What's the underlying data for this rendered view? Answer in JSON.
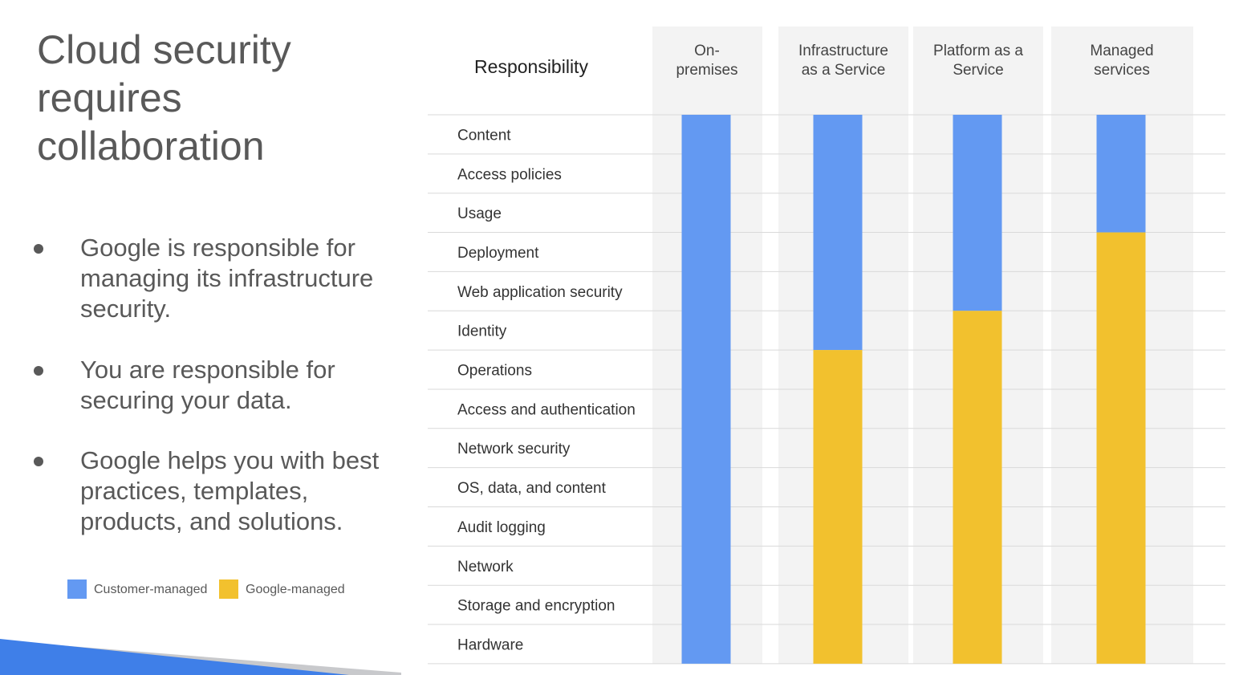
{
  "title": [
    "Cloud security",
    "requires",
    "collaboration"
  ],
  "bullets": [
    {
      "lines": [
        "Google is responsible for",
        "managing its infrastructure",
        "security."
      ]
    },
    {
      "lines": [
        "You are responsible for",
        "securing your data."
      ]
    },
    {
      "lines": [
        "Google helps you with best",
        "practices, templates,",
        "products, and solutions."
      ]
    }
  ],
  "legend": [
    {
      "label": "Customer-managed",
      "color": "#6399f2"
    },
    {
      "label": "Google-managed",
      "color": "#f2c12e"
    }
  ],
  "chart_data": {
    "type": "bar",
    "stacked": true,
    "orientation": "vertical",
    "row_header": "Responsibility",
    "responsibilities": [
      "Content",
      "Access policies",
      "Usage",
      "Deployment",
      "Web application security",
      "Identity",
      "Operations",
      "Access and authentication",
      "Network security",
      "OS, data, and content",
      "Audit logging",
      "Network",
      "Storage and encryption",
      "Hardware"
    ],
    "categories": [
      [
        "On-",
        "premises"
      ],
      [
        "Infrastructure",
        "as a Service"
      ],
      [
        "Platform as a",
        "Service"
      ],
      [
        "Managed",
        "services"
      ]
    ],
    "series": [
      {
        "name": "Customer-managed",
        "color": "#6399f2",
        "values": [
          14,
          6,
          5,
          3
        ]
      },
      {
        "name": "Google-managed",
        "color": "#f2c12e",
        "values": [
          0,
          8,
          9,
          11
        ]
      }
    ],
    "units": "responsibility rows (of 14)"
  }
}
